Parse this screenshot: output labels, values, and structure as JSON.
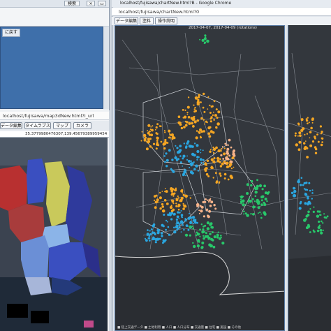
{
  "top_left": {
    "toolbar": {
      "button_1": "検索",
      "button_2": "×",
      "button_3": "▭"
    },
    "back_button": "に戻す"
  },
  "bottom_left": {
    "url": "localhost/fujisawa/map3dNew.html?i_url",
    "buttons": [
      "データ編集",
      "タイムラプス",
      "マップ",
      "カメラ"
    ],
    "coordinates": "35.3779980476307,139.45679389959454",
    "region_colors": [
      "#b83030",
      "#2f3a9c",
      "#c9c95b",
      "#6b8fd6",
      "#8bb4e8",
      "#3a4fc0",
      "#a7b6d9",
      "#243a7a"
    ]
  },
  "right_window": {
    "title": "localhost/fujisawa/chartNew.html?B - Google Chrome",
    "url": "localhost/fujisawa/chartNew.html?0",
    "tabs": [
      "データ編集",
      "塗料",
      "操作説明"
    ],
    "map_label": "2017-04-07, 2017-04-09 (rotations)",
    "attribution": "■ 陸上交通データ ■ 土地利用 ■ 人口 ■ 人口分布 ■ 交通量 ■ 住宅 ■ 施設 ■ その他",
    "point_colors": {
      "orange": "#f5a623",
      "blue": "#2aa6e0",
      "green": "#28c76a",
      "peach": "#f7b38a"
    }
  }
}
